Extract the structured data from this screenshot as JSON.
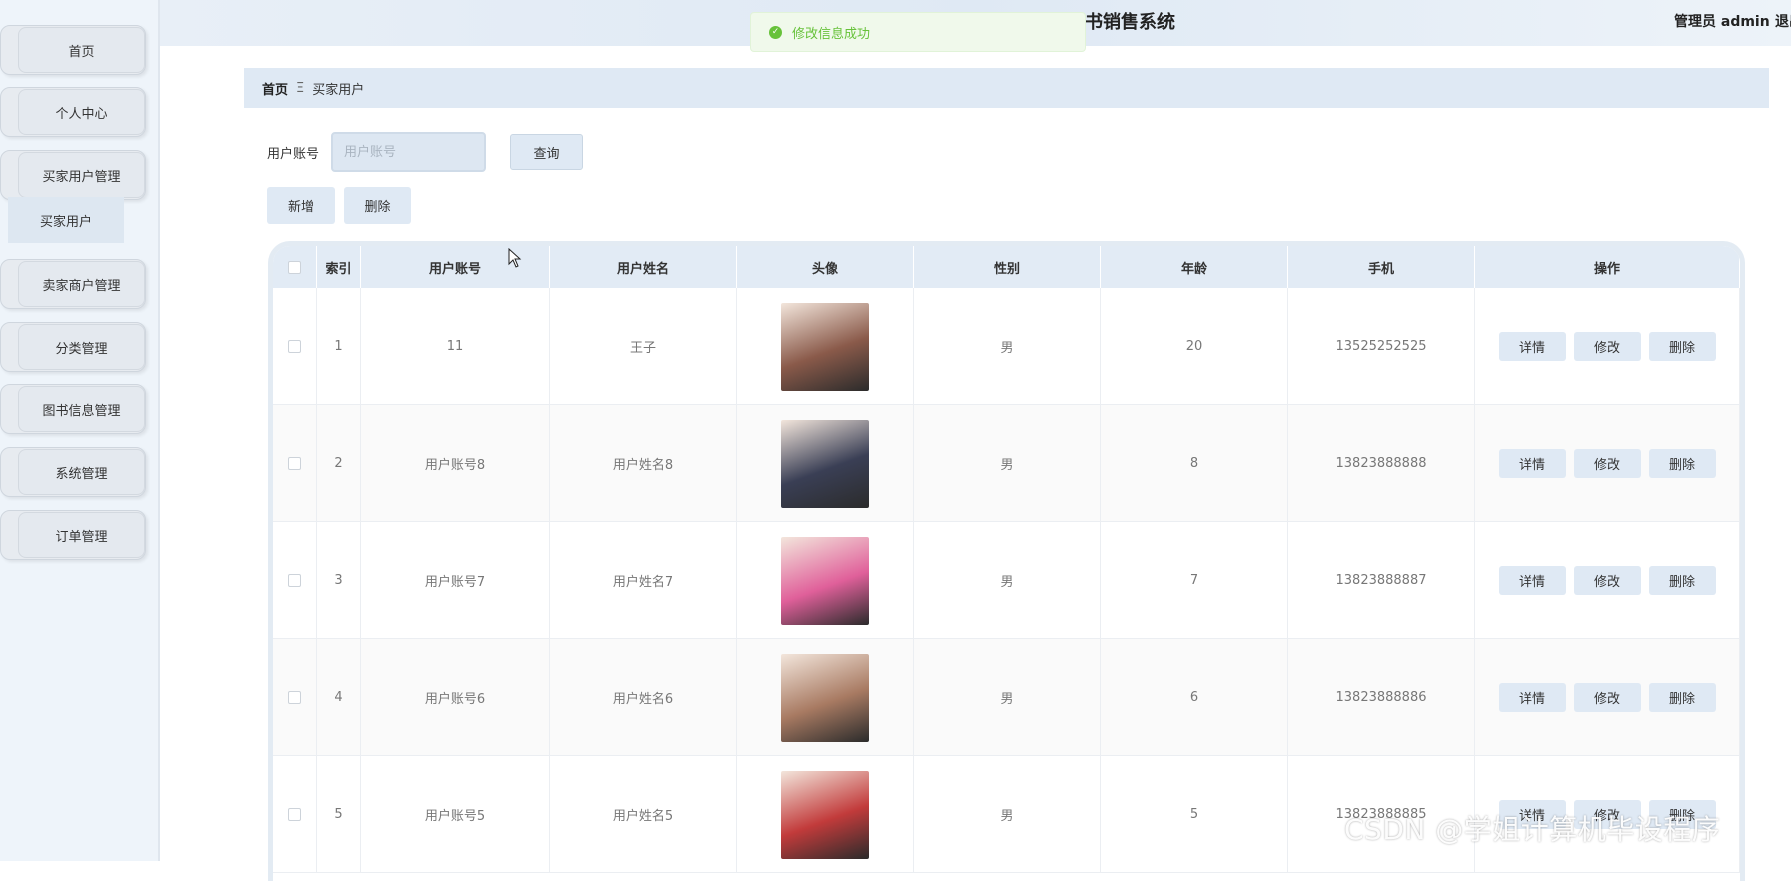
{
  "header": {
    "title": "书销售系统",
    "user_info": "管理员 admin",
    "logout_label": "退出"
  },
  "toast": {
    "message": "修改信息成功",
    "color": "#67c23a"
  },
  "sidebar": {
    "items": [
      {
        "label": "首页"
      },
      {
        "label": "个人中心"
      },
      {
        "label": "买家用户管理"
      },
      {
        "label": "卖家商户管理"
      },
      {
        "label": "分类管理"
      },
      {
        "label": "图书信息管理"
      },
      {
        "label": "系统管理"
      },
      {
        "label": "订单管理"
      }
    ],
    "submenu": {
      "label": "买家用户"
    }
  },
  "breadcrumb": {
    "home": "首页",
    "separator": "Ξ",
    "current": "买家用户"
  },
  "search": {
    "label": "用户账号",
    "placeholder": "用户账号",
    "query_label": "查询"
  },
  "toolbar": {
    "add_label": "新增",
    "delete_label": "删除"
  },
  "table": {
    "columns": [
      "索引",
      "用户账号",
      "用户姓名",
      "头像",
      "性别",
      "年龄",
      "手机",
      "操作"
    ],
    "rows": [
      {
        "index": "1",
        "account": "11",
        "name": "王子",
        "gender": "男",
        "age": "20",
        "phone": "13525252525",
        "avatar_color": "#8a5a4a"
      },
      {
        "index": "2",
        "account": "用户账号8",
        "name": "用户姓名8",
        "gender": "男",
        "age": "8",
        "phone": "13823888888",
        "avatar_color": "#3a3f55"
      },
      {
        "index": "3",
        "account": "用户账号7",
        "name": "用户姓名7",
        "gender": "男",
        "age": "7",
        "phone": "13823888887",
        "avatar_color": "#e0609a"
      },
      {
        "index": "4",
        "account": "用户账号6",
        "name": "用户姓名6",
        "gender": "男",
        "age": "6",
        "phone": "13823888886",
        "avatar_color": "#a87a62"
      },
      {
        "index": "5",
        "account": "用户账号5",
        "name": "用户姓名5",
        "gender": "男",
        "age": "5",
        "phone": "13823888885",
        "avatar_color": "#c23b3b"
      }
    ],
    "actions": {
      "detail_label": "详情",
      "edit_label": "修改",
      "delete_label": "删除"
    }
  },
  "watermark": "CSDN @学姐计算机毕设程序"
}
